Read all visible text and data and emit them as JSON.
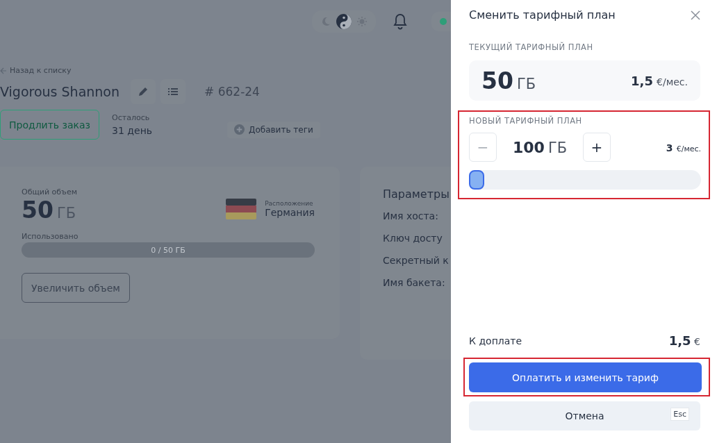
{
  "header": {
    "theme_modes": [
      {
        "kind": "dark",
        "selected": false
      },
      {
        "kind": "auto",
        "selected": true
      },
      {
        "kind": "light",
        "selected": false
      }
    ]
  },
  "order": {
    "back_link": "Назад к списку",
    "title": "Vigorous Shannon",
    "number_mark": "#",
    "number": "662-24",
    "extend_button": "Продлить заказ",
    "remaining_label": "Осталось",
    "remaining_value": "31 день",
    "add_tags_button": "Добавить теги"
  },
  "storage_card": {
    "total_label": "Общий объем",
    "total_value": "50",
    "total_unit": "ГБ",
    "location_label": "Расположение",
    "location_value": "Германия",
    "used_label": "Использовано",
    "usage": {
      "reading": "0 / 50 ГБ"
    },
    "increase_button": "Увеличить объем"
  },
  "params_card": {
    "title": "Параметры",
    "fields": [
      "Имя хоста:",
      "Ключ досту",
      "Секретный к",
      "Имя бакета:"
    ]
  },
  "panel": {
    "title": "Сменить тарифный план",
    "current_label": "ТЕКУЩИЙ ТАРИФНЫЙ ПЛАН",
    "current_value": "50",
    "current_unit": "ГБ",
    "current_price": "1,5",
    "current_price_unit": "€/мес.",
    "new_label": "НОВЫЙ ТАРИФНЫЙ ПЛАН",
    "minus": "−",
    "new_value": "100",
    "new_unit": "ГБ",
    "plus": "+",
    "new_price": "3",
    "new_price_unit": "€/мес.",
    "slider": {
      "level": 0,
      "disabled_minus": true
    },
    "due_label": "К доплате",
    "due_value": "1,5",
    "due_unit": "€",
    "pay_button": "Оплатить и изменить тариф",
    "cancel_button": "Отмена",
    "cancel_key": "Esc"
  }
}
